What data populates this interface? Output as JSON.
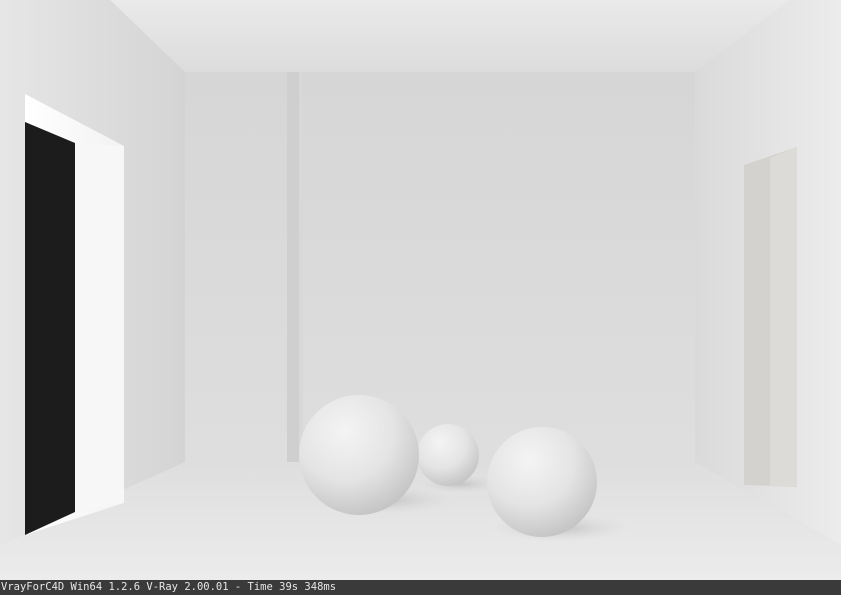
{
  "render": {
    "scene": "white room render with three spheres",
    "status_text": "VrayForC4D Win64 1.2.6 V-Ray 2.00.01 - Time 39s 348ms"
  },
  "colors": {
    "status_bar_bg": "#3a3a3a",
    "status_bar_text": "#e8e8e8",
    "door_opening": "#1c1c1c"
  }
}
